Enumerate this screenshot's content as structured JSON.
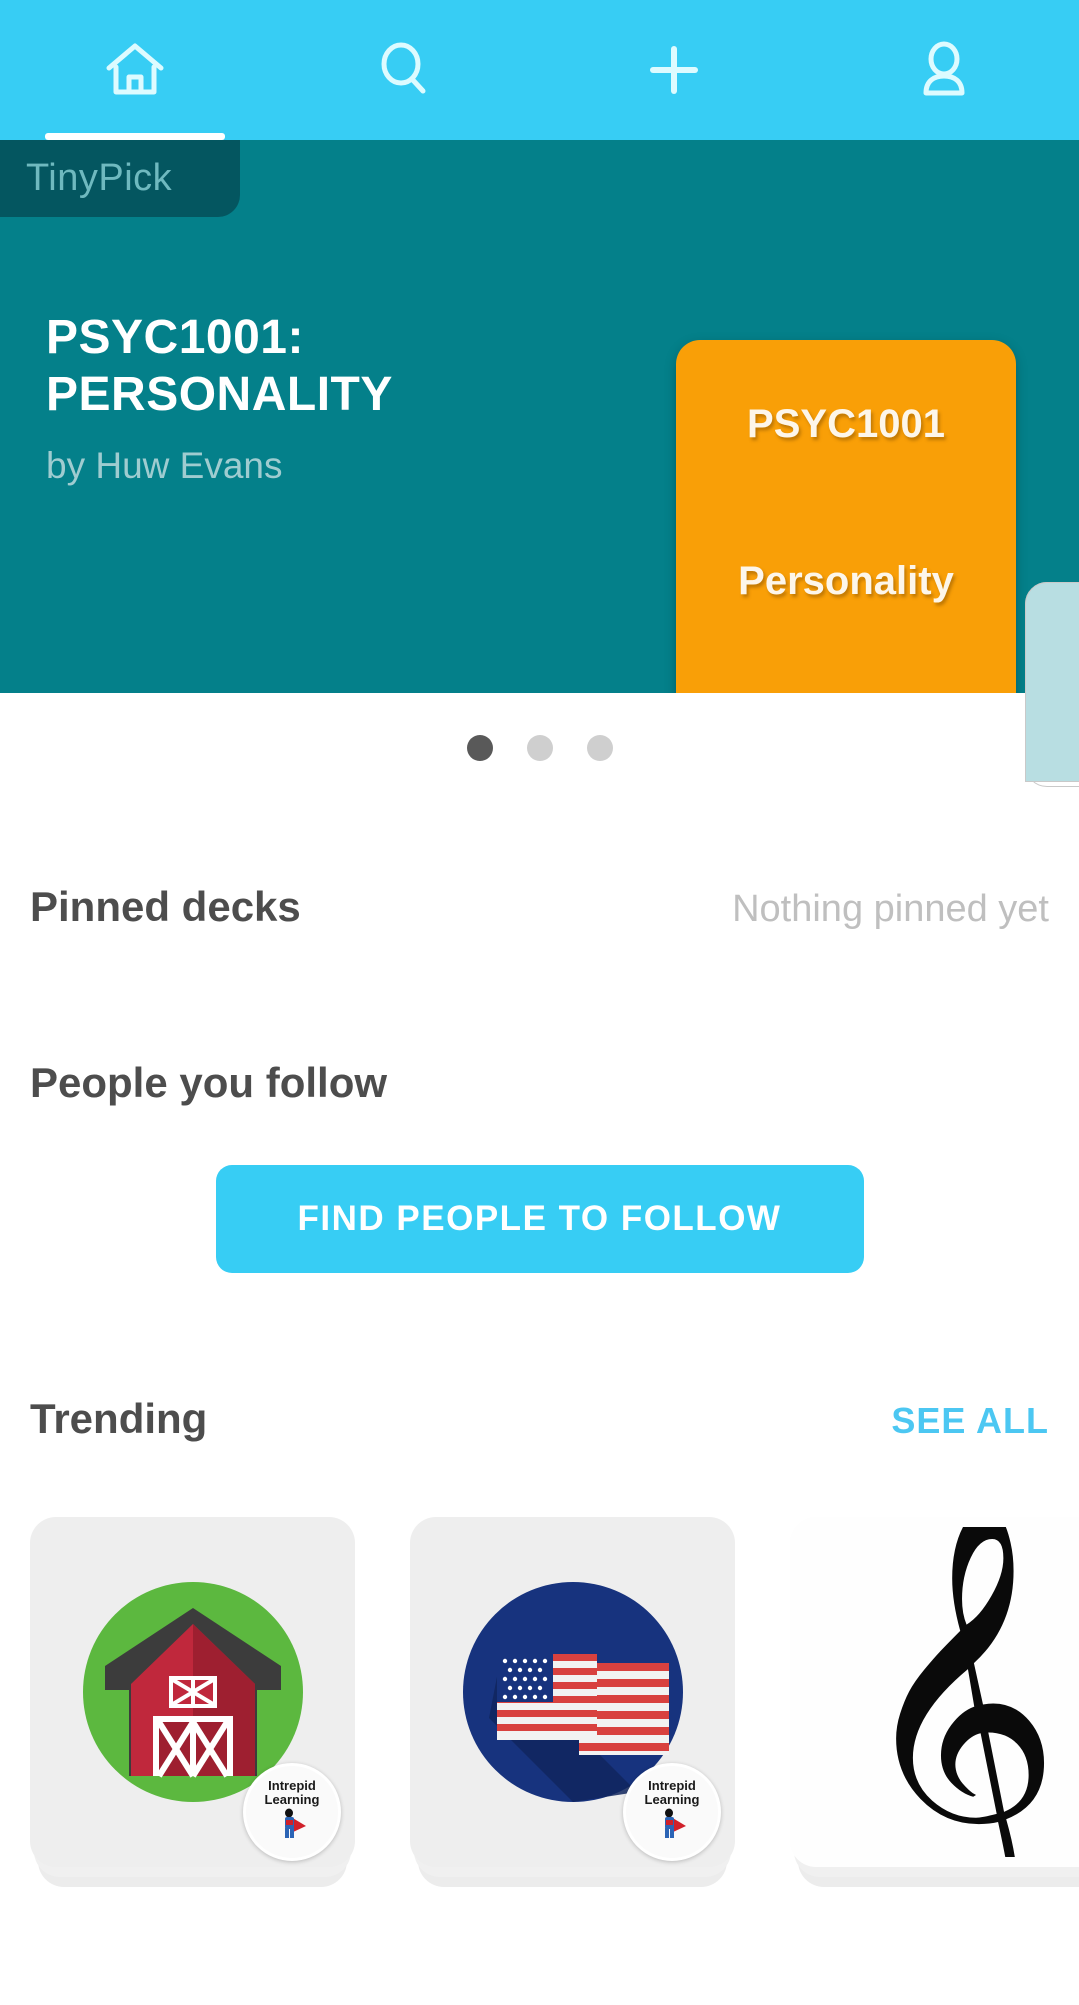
{
  "nav": {
    "tabs": [
      {
        "icon": "home-icon",
        "name": "home",
        "active": true
      },
      {
        "icon": "search-icon",
        "name": "search",
        "active": false
      },
      {
        "icon": "plus-icon",
        "name": "create",
        "active": false
      },
      {
        "icon": "profile-icon",
        "name": "profile",
        "active": false
      }
    ]
  },
  "hero": {
    "badge_label": "TinyPick",
    "title": "PSYC1001: PERSONALITY",
    "author": "by Huw Evans",
    "deck_card": {
      "code": "PSYC1001",
      "name": "Personality",
      "color": "#f99f07"
    },
    "background_color": "#04808a",
    "dots": {
      "count": 3,
      "active_index": 0
    }
  },
  "sections": {
    "pinned": {
      "title": "Pinned decks",
      "empty_text": "Nothing pinned yet"
    },
    "follow": {
      "title": "People you follow",
      "button_label": "FIND PEOPLE TO FOLLOW"
    },
    "trending": {
      "title": "Trending",
      "see_all_label": "SEE ALL",
      "cards": [
        {
          "art": "barn-icon",
          "background": "#eeeeee",
          "avatar": {
            "line1": "Intrepid",
            "line2": "Learning"
          }
        },
        {
          "art": "usa-flag-icon",
          "background": "#eeeeee",
          "avatar": {
            "line1": "Intrepid",
            "line2": "Learning"
          }
        },
        {
          "art": "treble-clef-icon",
          "background": "#fefefe",
          "avatar": null
        }
      ]
    }
  },
  "colors": {
    "accent": "#37cdf4",
    "hero_teal": "#04808a",
    "badge_teal": "#045660",
    "deck_orange": "#f99f07",
    "link_blue": "#4cc7f2"
  }
}
